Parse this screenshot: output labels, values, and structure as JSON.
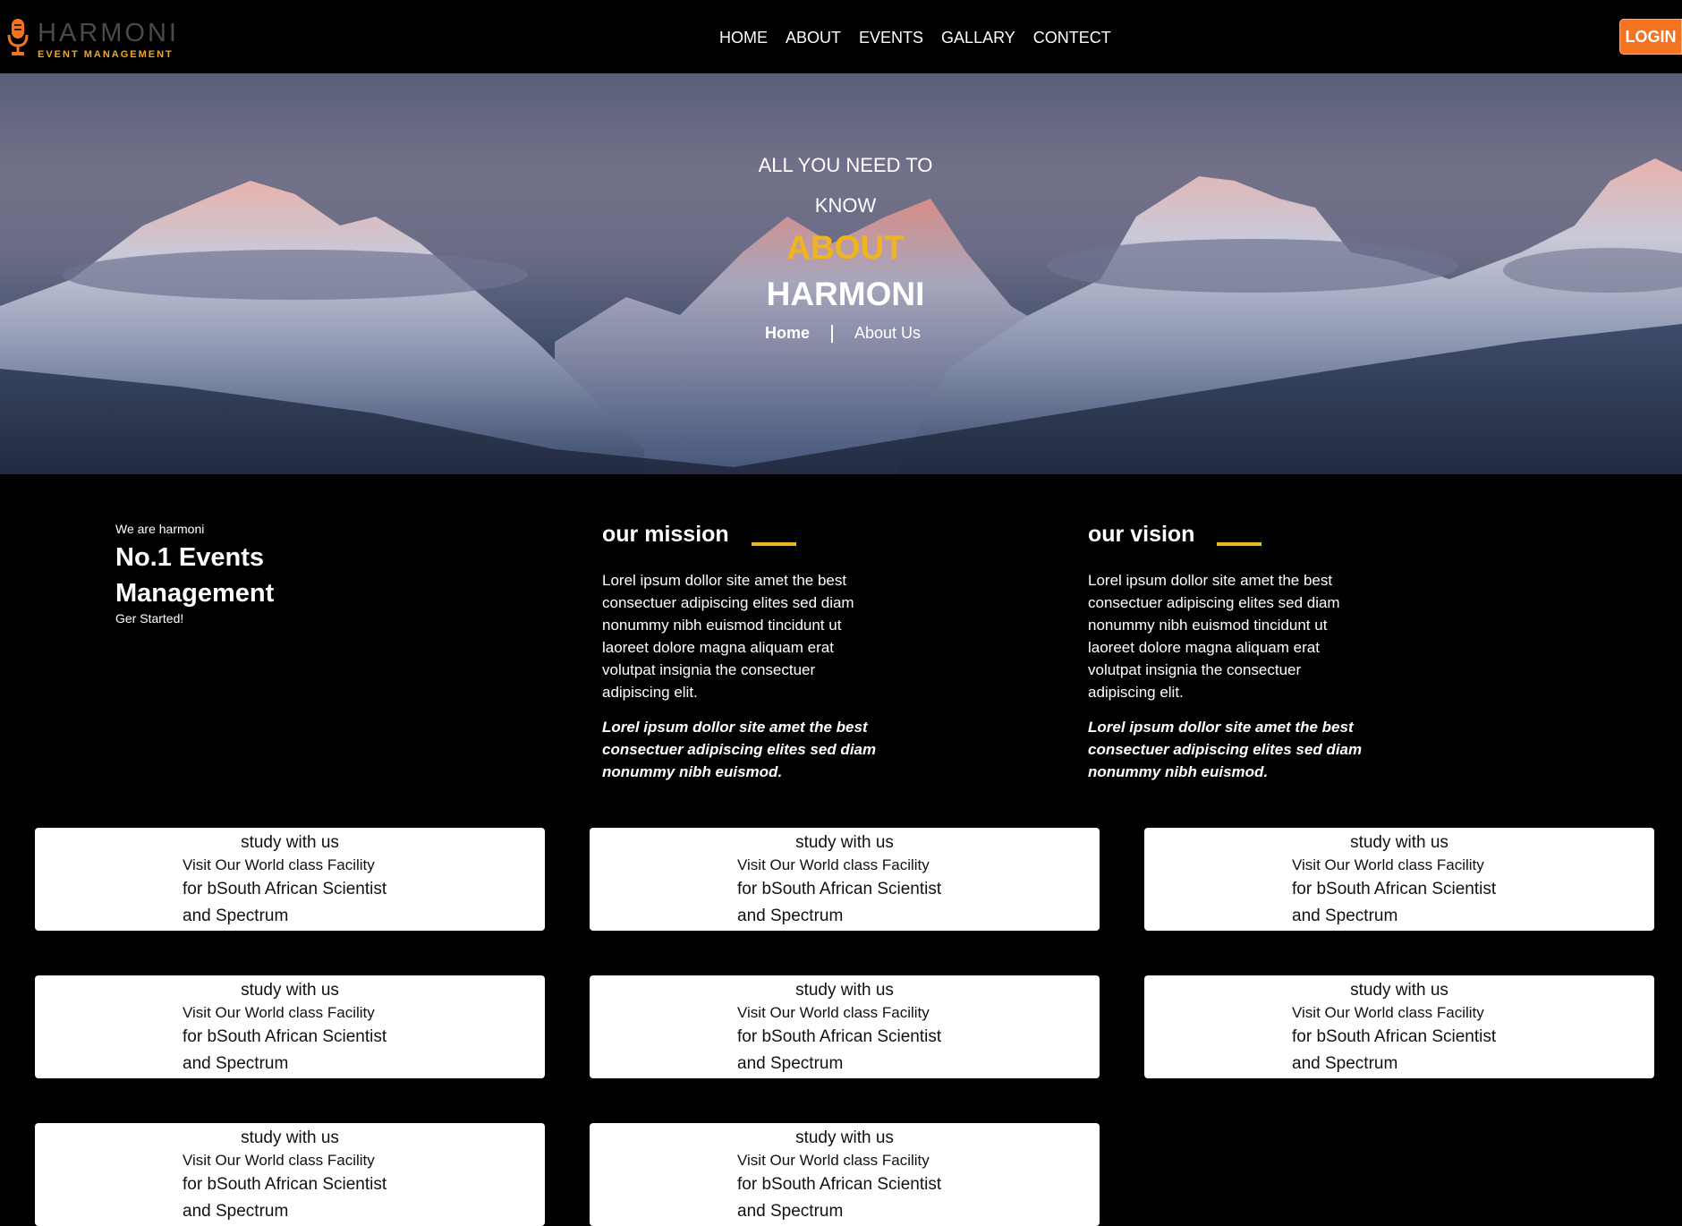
{
  "brand": {
    "name": "HARMONI",
    "tagline": "EVENT MANAGEMENT",
    "icon": "microphone-icon",
    "accent": "#f0a622"
  },
  "nav": {
    "items": [
      {
        "label": "HOME"
      },
      {
        "label": "ABOUT"
      },
      {
        "label": "EVENTS"
      },
      {
        "label": "GALLARY"
      },
      {
        "label": "CONTECT"
      }
    ],
    "login_label": "LOGIN",
    "login_color": "#f47321"
  },
  "hero": {
    "line1": "ALL YOU NEED TO",
    "line2": "KNOW",
    "highlight": "ABOUT",
    "title": "HARMONI",
    "highlight_color": "#f0b41c",
    "breadcrumb": {
      "home": "Home",
      "current": "About Us"
    }
  },
  "intro": {
    "small": "We are harmoni",
    "title": "No.1 Events Management",
    "cta": "Ger Started!"
  },
  "mission": {
    "title": "our mission",
    "body": "Lorel ipsum dollor site amet the best consectuer adipiscing elites sed diam nonummy nibh euismod tincidunt ut laoreet dolore magna aliquam erat volutpat insignia the consectuer adipiscing elit.",
    "emphasis": "Lorel ipsum dollor site amet the best consectuer adipiscing elites sed diam nonummy nibh euismod."
  },
  "vision": {
    "title": "our vision",
    "body": "Lorel ipsum dollor site amet the best consectuer adipiscing elites sed diam nonummy nibh euismod tincidunt ut laoreet dolore magna aliquam erat volutpat insignia the consectuer adipiscing elit.",
    "emphasis": "Lorel ipsum dollor site amet the best consectuer adipiscing elites sed diam nonummy nibh euismod."
  },
  "cards": [
    {
      "title": "study with us",
      "line1": "Visit Our World class Facility",
      "line2": "for bSouth African Scientist",
      "line3": "and Spectrum"
    },
    {
      "title": "study with us",
      "line1": "Visit Our World class Facility",
      "line2": "for bSouth African Scientist",
      "line3": "and Spectrum"
    },
    {
      "title": "study with us",
      "line1": "Visit Our World class Facility",
      "line2": "for bSouth African Scientist",
      "line3": "and Spectrum"
    },
    {
      "title": "study with us",
      "line1": "Visit Our World class Facility",
      "line2": "for bSouth African Scientist",
      "line3": "and Spectrum"
    },
    {
      "title": "study with us",
      "line1": "Visit Our World class Facility",
      "line2": "for bSouth African Scientist",
      "line3": "and Spectrum"
    },
    {
      "title": "study with us",
      "line1": "Visit Our World class Facility",
      "line2": "for bSouth African Scientist",
      "line3": "and Spectrum"
    },
    {
      "title": "study with us",
      "line1": "Visit Our World class Facility",
      "line2": "for bSouth African Scientist",
      "line3": "and Spectrum"
    },
    {
      "title": "study with us",
      "line1": "Visit Our World class Facility",
      "line2": "for bSouth African Scientist",
      "line3": "and Spectrum"
    }
  ]
}
